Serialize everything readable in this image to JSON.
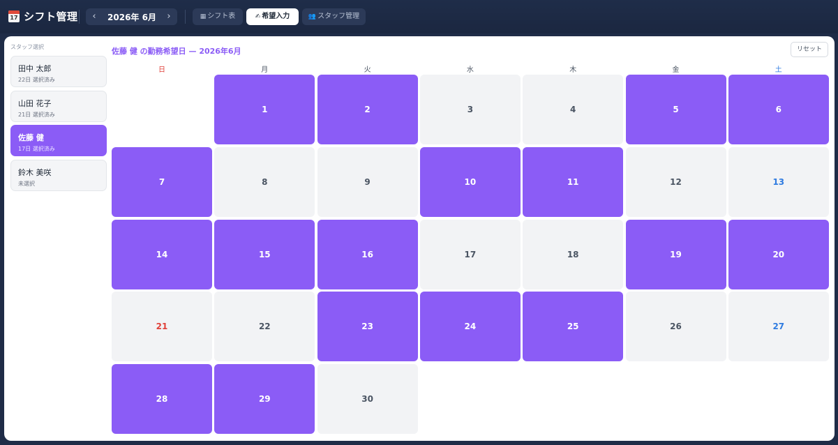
{
  "header": {
    "app_icon_day": "17",
    "app_title": "シフト管理",
    "prev": "‹",
    "next": "›",
    "month": "2026年 6月",
    "tabs": [
      {
        "icon": "▦",
        "label": "シフト表"
      },
      {
        "icon": "✍",
        "label": "希望入力"
      },
      {
        "icon": "👥",
        "label": "スタッフ管理"
      }
    ]
  },
  "sidebar": {
    "label": "スタッフ選択",
    "staff": [
      {
        "name": "田中 太郎",
        "status": "22日 選択済み"
      },
      {
        "name": "山田 花子",
        "status": "21日 選択済み"
      },
      {
        "name": "佐藤 健",
        "status": "17日 選択済み"
      },
      {
        "name": "鈴木 美咲",
        "status": "未選択"
      }
    ],
    "selected_index": 2
  },
  "calendar": {
    "title": "佐藤 健 の勤務希望日 — 2026年6月",
    "reset_label": "リセット",
    "weekdays": [
      "日",
      "月",
      "火",
      "水",
      "木",
      "金",
      "土"
    ],
    "first_weekday": 1,
    "days_in_month": 30,
    "selected_days": [
      1,
      2,
      5,
      6,
      7,
      10,
      11,
      14,
      15,
      16,
      19,
      20,
      23,
      24,
      25,
      28,
      29
    ],
    "colors": {
      "selected": "#8b5cf6",
      "unselected": "#f2f3f5",
      "sunday": "#e0413a",
      "saturday": "#2f7be0"
    }
  }
}
